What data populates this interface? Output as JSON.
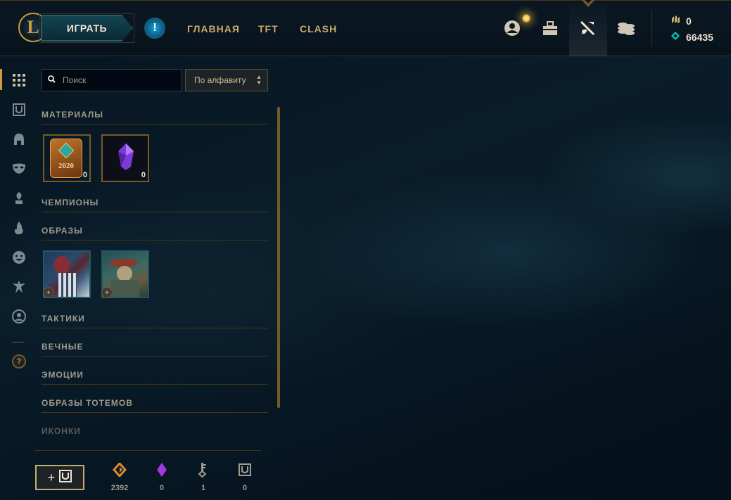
{
  "topbar": {
    "play_label": "ИГРАТЬ",
    "nav": [
      "ГЛАВНАЯ",
      "TFT",
      "CLASH"
    ],
    "icons": [
      "profile-icon",
      "collection-icon",
      "loot-icon",
      "store-icon"
    ],
    "currency": {
      "rp": "0",
      "blue_essence": "66435"
    }
  },
  "sidebar": {
    "icons": [
      "all-grid-icon",
      "chest-icon",
      "champion-helmet-icon",
      "skin-mask-icon",
      "ward-icon",
      "eternals-flame-icon",
      "emote-icon",
      "totem-icon",
      "profile-icon-icon",
      "help-icon"
    ],
    "help_label": "?"
  },
  "filter": {
    "search_placeholder": "Поиск",
    "sort_label": "По алфавиту"
  },
  "sections": {
    "materials": "МАТЕРИАЛЫ",
    "champions": "ЧЕМПИОНЫ",
    "skins": "ОБРАЗЫ",
    "tactics": "ТАКТИКИ",
    "eternals": "ВЕЧНЫЕ",
    "emotes": "ЭМОЦИИ",
    "ward_skins": "ОБРАЗЫ ТОТЕМОВ",
    "icons": "ИКОНКИ"
  },
  "materials": [
    {
      "name": "2020-token",
      "label": "2020",
      "count": "0"
    },
    {
      "name": "mythic-essence",
      "count": "0"
    }
  ],
  "skins": [
    {
      "name": "skin-shard-1"
    },
    {
      "name": "skin-shard-2"
    }
  ],
  "footer": {
    "craft_label": "+",
    "orange_essence": "2392",
    "mythic_essence": "0",
    "keys": "1",
    "chests": "0"
  },
  "colors": {
    "gold": "#c89b3c",
    "gold_dark": "#785a28",
    "teal": "#1e5a63",
    "bg": "#010a13"
  }
}
